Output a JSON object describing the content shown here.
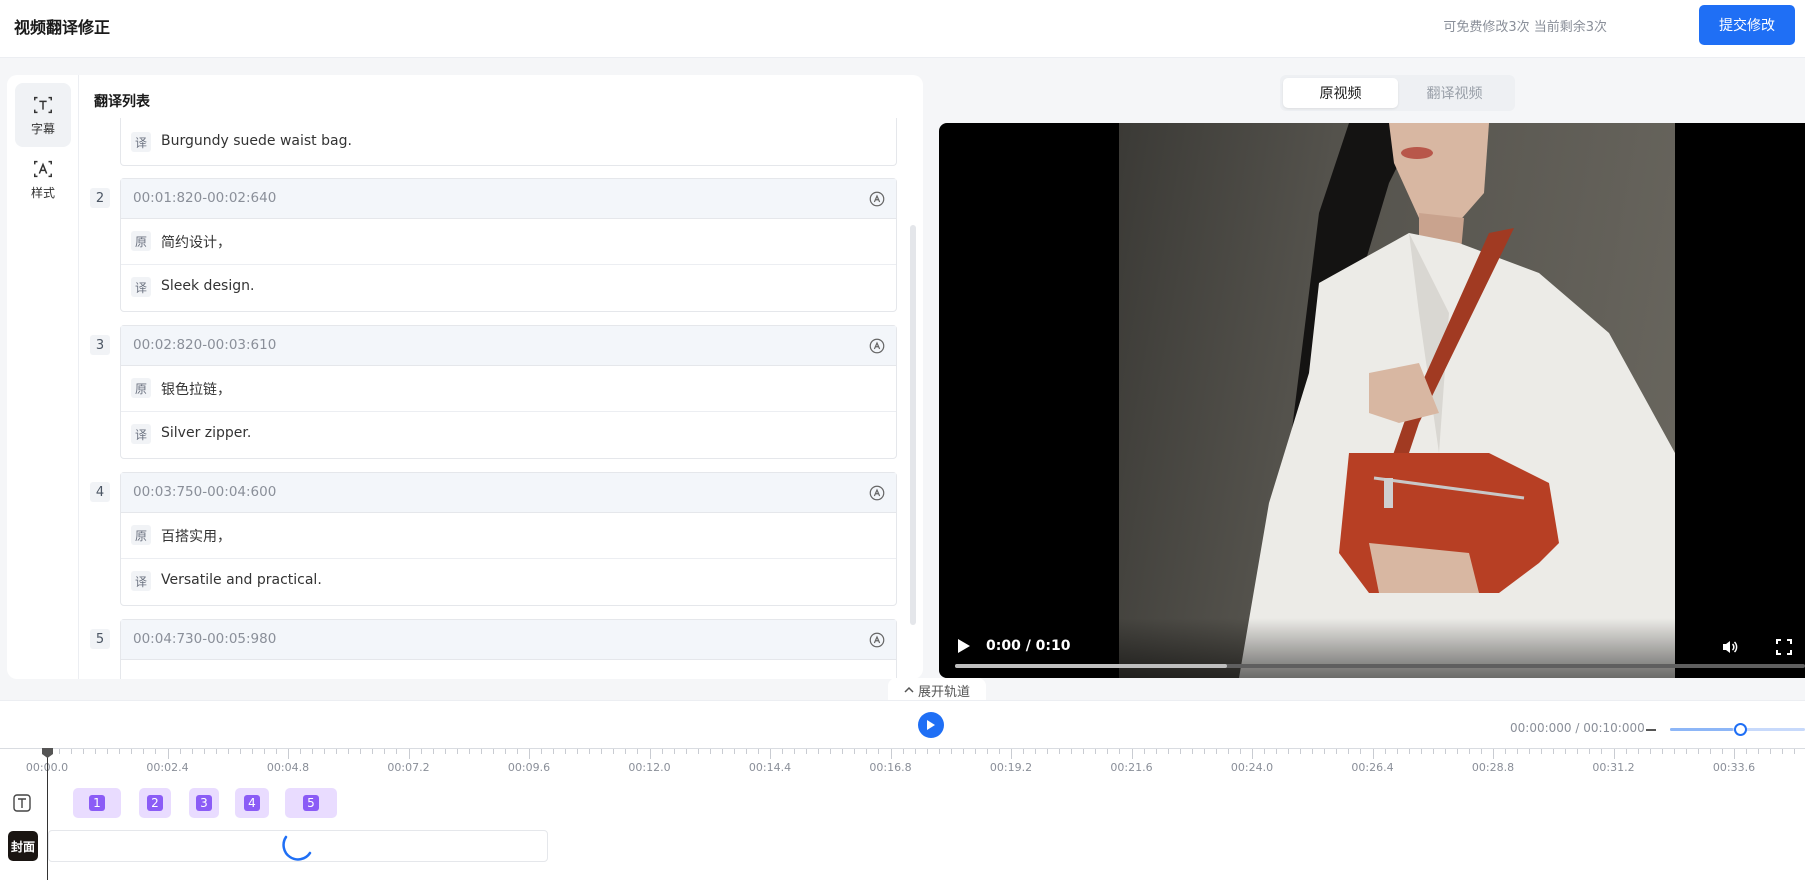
{
  "header": {
    "title": "视频翻译修正",
    "quota_text": "可免费修改3次 当前剩余3次",
    "submit_label": "提交修改"
  },
  "sidebar": {
    "items": [
      {
        "label": "字幕",
        "icon": "subtitle-icon"
      },
      {
        "label": "样式",
        "icon": "style-icon"
      }
    ]
  },
  "list": {
    "title": "翻译列表",
    "partial_first": {
      "tag": "译",
      "text": "Burgundy suede waist bag."
    },
    "entries": [
      {
        "num": "2",
        "time": "00:01:820-00:02:640",
        "orig_tag": "原",
        "orig": "简约设计，",
        "trans_tag": "译",
        "trans": "Sleek design."
      },
      {
        "num": "3",
        "time": "00:02:820-00:03:610",
        "orig_tag": "原",
        "orig": "银色拉链，",
        "trans_tag": "译",
        "trans": "Silver zipper."
      },
      {
        "num": "4",
        "time": "00:03:750-00:04:600",
        "orig_tag": "原",
        "orig": "百搭实用，",
        "trans_tag": "译",
        "trans": "Versatile and practical."
      },
      {
        "num": "5",
        "time": "00:04:730-00:05:980"
      }
    ]
  },
  "video_tabs": {
    "original": "原视频",
    "translated": "翻译视频",
    "active": "original"
  },
  "video": {
    "time": "0:00 / 0:10",
    "buffered": 0.32
  },
  "timeline": {
    "expand_label": "展开轨道",
    "time": "00:00:000 / 00:10:000",
    "zoom_level": 0.47,
    "ticks": [
      "00:00.0",
      "00:02.4",
      "00:04.8",
      "00:07.2",
      "00:09.6",
      "00:12.0",
      "00:14.4",
      "00:16.8",
      "00:19.2",
      "00:21.6",
      "00:24.0",
      "00:26.4",
      "00:28.8",
      "00:31.2",
      "00:33.6"
    ],
    "clips": [
      "1",
      "2",
      "3",
      "4",
      "5"
    ],
    "cover_label": "封面"
  },
  "colors": {
    "accent": "#1f6ff5",
    "clip": "#8b5cf6",
    "clip_bg": "#e9dcff"
  }
}
